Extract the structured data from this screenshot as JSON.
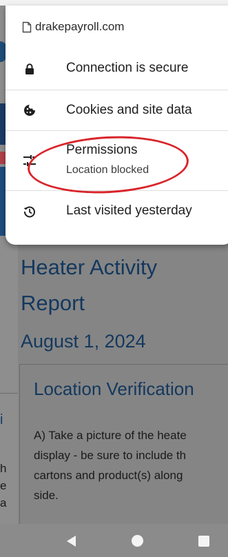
{
  "popup": {
    "url": "drakepayroll.com",
    "items": [
      {
        "label": "Connection is secure",
        "icon": "lock-icon"
      },
      {
        "label": "Cookies and site data",
        "icon": "cookie-icon"
      },
      {
        "label": "Permissions",
        "sublabel": "Location blocked",
        "icon": "tune-icon"
      },
      {
        "label": "Last visited yesterday",
        "icon": "history-icon"
      }
    ]
  },
  "page": {
    "title_line1": "Heater Activity",
    "title_line2": "Report",
    "date": "August 1, 2024",
    "card_title": "Location Verification",
    "card_lines": [
      "A) Take a picture of the heate",
      "display - be sure to include th",
      "cartons and product(s) along",
      "side."
    ],
    "left_fragments": [
      "i",
      "h",
      "e",
      "a"
    ]
  },
  "colors": {
    "highlight": "#d9252b",
    "heading": "#14385e"
  }
}
